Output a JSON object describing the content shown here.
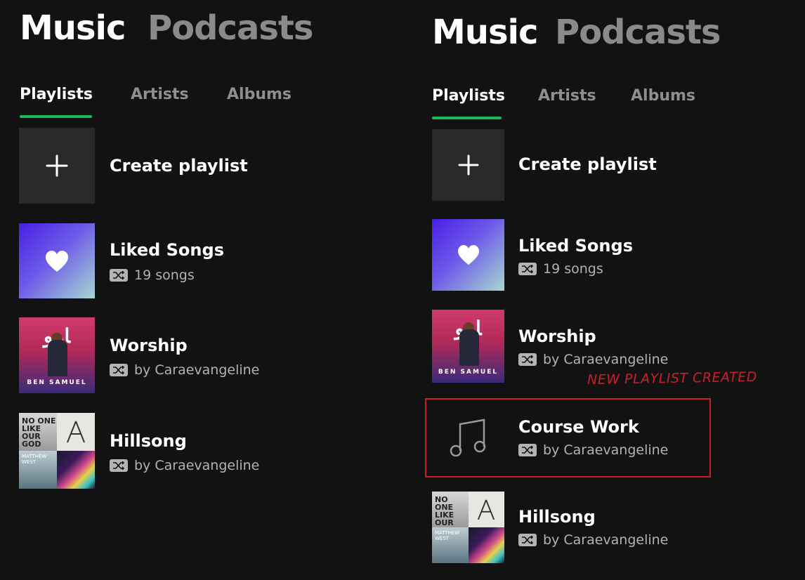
{
  "colors": {
    "background": "#121212",
    "accent_green": "#1db954",
    "annotation_red": "#c8202a",
    "inactive_text": "#8a8a8a",
    "secondary_text": "#b3b3b3"
  },
  "panels": [
    {
      "top_tabs": [
        "Music",
        "Podcasts"
      ],
      "active_top_tab": "Music",
      "sub_tabs": [
        "Playlists",
        "Artists",
        "Albums"
      ],
      "active_sub_tab": "Playlists",
      "create_playlist_label": "Create playlist",
      "items": [
        {
          "title": "Liked Songs",
          "subtitle": "19 songs",
          "icon": "heart-icon"
        },
        {
          "title": "Worship",
          "subtitle": "by Caraevangeline",
          "art_text": "BEN SAMUEL"
        },
        {
          "title": "Hillsong",
          "subtitle": "by Caraevangeline",
          "art_text": "NO ONE LIKE OUR GOD"
        }
      ]
    },
    {
      "top_tabs": [
        "Music",
        "Podcasts"
      ],
      "active_top_tab": "Music",
      "sub_tabs": [
        "Playlists",
        "Artists",
        "Albums"
      ],
      "active_sub_tab": "Playlists",
      "create_playlist_label": "Create playlist",
      "items": [
        {
          "title": "Liked Songs",
          "subtitle": "19 songs",
          "icon": "heart-icon"
        },
        {
          "title": "Worship",
          "subtitle": "by Caraevangeline",
          "art_text": "BEN SAMUEL"
        },
        {
          "title": "Course Work",
          "subtitle": "by Caraevangeline",
          "icon": "music-note-icon"
        },
        {
          "title": "Hillsong",
          "subtitle": "by Caraevangeline",
          "art_text": "NO ONE LIKE OUR GOD"
        }
      ],
      "annotation": "NEW PLAYLIST CREATED"
    }
  ]
}
